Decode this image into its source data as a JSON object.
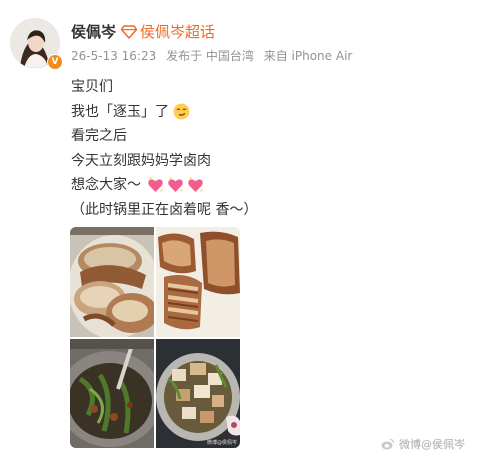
{
  "post": {
    "author": "侯佩岑",
    "super_topic": "侯佩岑超话",
    "date": "26-5-13 16:23",
    "location": "发布于 中国台湾",
    "device": "来自 iPhone Air",
    "lines": [
      "宝贝们",
      "我也「逐玉」了",
      "看完之后",
      "今天立刻跟妈妈学卤肉",
      "想念大家～",
      "（此时锅里正在卤着呢 香～）"
    ],
    "photo_watermark": "微博@侯佩岑"
  },
  "watermark": "微博@侯佩岑"
}
